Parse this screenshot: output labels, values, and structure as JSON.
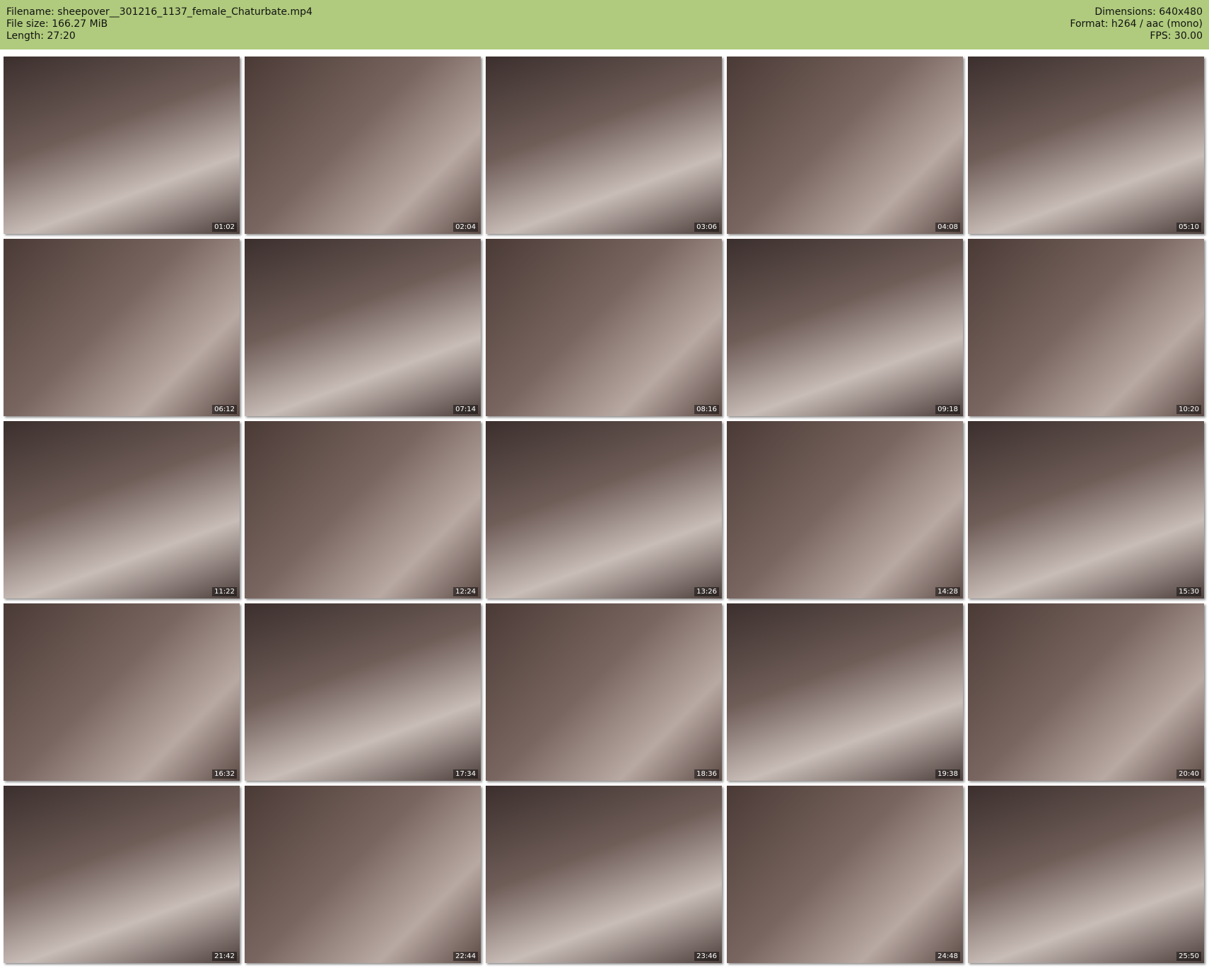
{
  "header": {
    "filename": "Filename: sheepover__301216_1137_female_Chaturbate.mp4",
    "filesize": "File size: 166.27 MiB",
    "length": "Length: 27:20",
    "dimensions": "Dimensions: 640x480",
    "format": "Format: h264 / aac (mono)",
    "fps": "FPS: 30.00"
  },
  "thumbnails": [
    "01:02",
    "02:04",
    "03:06",
    "04:08",
    "05:10",
    "06:12",
    "07:14",
    "08:16",
    "09:18",
    "10:20",
    "11:22",
    "12:24",
    "13:26",
    "14:28",
    "15:30",
    "16:32",
    "17:34",
    "18:36",
    "19:38",
    "20:40",
    "21:42",
    "22:44",
    "23:46",
    "24:48",
    "25:50"
  ]
}
